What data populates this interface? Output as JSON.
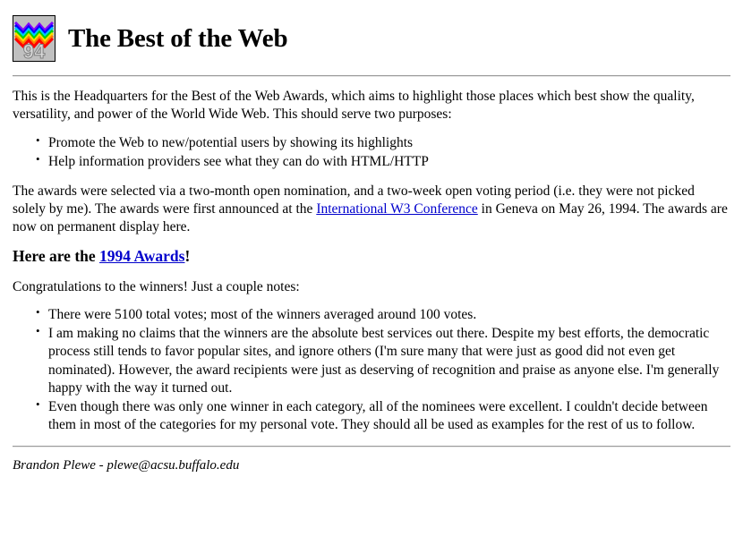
{
  "header": {
    "logo_alt": "best-of-the-web-1994-award-logo",
    "logo_year": "94",
    "title": "The Best of the Web"
  },
  "intro": {
    "paragraph": "This is the Headquarters for the Best of the Web Awards, which aims to highlight those places which best show the quality, versatility, and power of the World Wide Web. This should serve two purposes:",
    "purposes": [
      "Promote the Web to new/potential users by showing its highlights",
      "Help information providers see what they can do with HTML/HTTP"
    ]
  },
  "selection": {
    "text_before_link": "The awards were selected via a two-month open nomination, and a two-week open voting period (i.e. they were not picked solely by me). The awards were first announced at the ",
    "link_label": "International W3 Conference",
    "text_after_link": " in Geneva on May 26, 1994. The awards are now on permanent display here."
  },
  "awards_heading": {
    "prefix": "Here are the ",
    "link_label": "1994 Awards",
    "suffix": "!"
  },
  "notes": {
    "lead": "Congratulations to the winners! Just a couple notes:",
    "items": [
      "There were 5100 total votes; most of the winners averaged around 100 votes.",
      "I am making no claims that the winners are the absolute best services out there. Despite my best efforts, the democratic process still tends to favor popular sites, and ignore others (I'm sure many that were just as good did not even get nominated). However, the award recipients were just as deserving of recognition and praise as anyone else. I'm generally happy with the way it turned out.",
      "Even though there was only one winner in each category, all of the nominees were excellent. I couldn't decide between them in most of the categories for my personal vote. They should all be used as examples for the rest of us to follow."
    ]
  },
  "footer": {
    "signature": "Brandon Plewe - plewe@acsu.buffalo.edu"
  },
  "colors": {
    "link": "#0000cc",
    "text": "#000000",
    "background": "#ffffff",
    "rule": "#9a9a9a",
    "logo_background": "#c0c0c0"
  }
}
